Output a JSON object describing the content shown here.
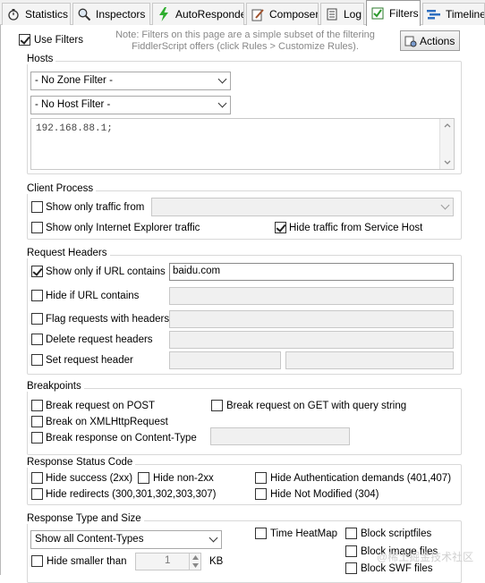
{
  "tabs": [
    {
      "label": "Statistics",
      "icon": "stopwatch-icon"
    },
    {
      "label": "Inspectors",
      "icon": "magnifier-icon"
    },
    {
      "label": "AutoResponder",
      "icon": "lightning-icon"
    },
    {
      "label": "Composer",
      "icon": "compose-icon"
    },
    {
      "label": "Log",
      "icon": "log-icon"
    },
    {
      "label": "Filters",
      "icon": "checkbox-icon"
    },
    {
      "label": "Timeline",
      "icon": "timeline-icon"
    }
  ],
  "active_tab": "Filters",
  "top": {
    "use_filters_label": "Use Filters",
    "use_filters_checked": true,
    "note_line1": "Note: Filters on this page are a simple subset of the filtering",
    "note_line2": "FiddlerScript offers (click Rules > Customize Rules).",
    "actions_label": "Actions"
  },
  "hosts": {
    "title": "Hosts",
    "zone_filter": "- No Zone Filter -",
    "host_filter": "- No Host Filter -",
    "hosts_text": "192.168.88.1;"
  },
  "client_process": {
    "title": "Client Process",
    "show_only_traffic_from": "Show only traffic from",
    "show_only_ie": "Show only Internet Explorer traffic",
    "hide_service_host": "Hide traffic from Service Host",
    "hide_service_host_checked": true
  },
  "request_headers": {
    "title": "Request Headers",
    "show_only_url_label": "Show only if URL contains",
    "show_only_url_checked": true,
    "show_only_url_value": "baidu.com",
    "hide_url_label": "Hide if URL contains",
    "flag_requests_label": "Flag requests with headers",
    "delete_headers_label": "Delete request headers",
    "set_header_label": "Set request header"
  },
  "breakpoints": {
    "title": "Breakpoints",
    "break_post": "Break request on POST",
    "break_get_query": "Break request on GET with query string",
    "break_xhr": "Break on XMLHttpRequest",
    "break_response_ct": "Break response on Content-Type"
  },
  "response_status": {
    "title": "Response Status Code",
    "hide_success": "Hide success (2xx)",
    "hide_non2xx": "Hide non-2xx",
    "hide_auth": "Hide Authentication demands (401,407)",
    "hide_redirects": "Hide redirects (300,301,302,303,307)",
    "hide_not_modified": "Hide Not Modified (304)"
  },
  "response_type": {
    "title": "Response Type and Size",
    "content_types": "Show all Content-Types",
    "time_heatmap": "Time HeatMap",
    "block_scriptfiles": "Block scriptfiles",
    "block_imagefiles": "Block image files",
    "block_swf": "Block SWF files",
    "hide_smaller_label": "Hide smaller than",
    "hide_smaller_value": "1",
    "kb_label": "KB"
  },
  "watermark": "@稀土掘金技术社区"
}
